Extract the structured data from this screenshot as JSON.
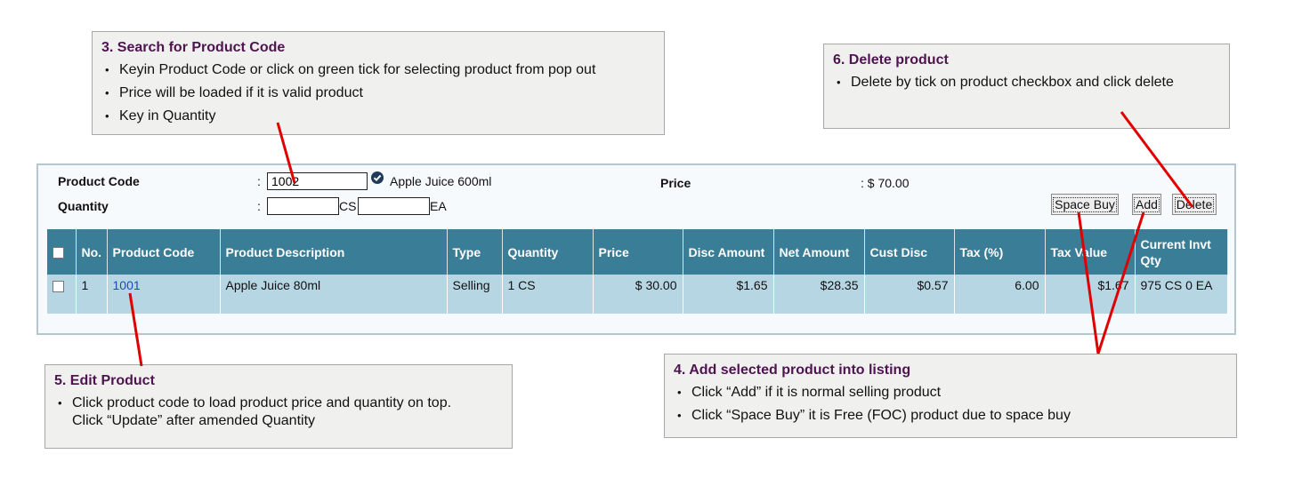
{
  "callouts": {
    "search": {
      "title": "3. Search for Product Code",
      "bullets": [
        "Keyin Product Code or click on green tick for selecting product from pop out",
        "Price will be loaded if it is valid product",
        "Key in Quantity"
      ]
    },
    "delete": {
      "title": "6. Delete product",
      "bullets": [
        "Delete by tick on product checkbox and click delete"
      ]
    },
    "edit": {
      "title": "5. Edit Product",
      "bullets": [
        "Click product code to load product price and quantity on top.\nClick “Update” after amended Quantity"
      ]
    },
    "add": {
      "title": "4. Add selected product into listing",
      "bullets": [
        "Click “Add” if it is normal selling product",
        "Click “Space Buy” it is Free (FOC) product due to space buy"
      ]
    }
  },
  "form": {
    "product_code_label": "Product Code",
    "quantity_label": "Quantity",
    "colon": ":",
    "product_code_value": "1002",
    "product_name": "Apple Juice 600ml",
    "price_label": "Price",
    "price_value": ": $ 70.00",
    "qty_cs_value": "",
    "qty_ea_value": "",
    "cs_unit": "CS",
    "ea_unit": "EA"
  },
  "buttons": {
    "space_buy": "Space Buy",
    "add": "Add",
    "delete": "Delete"
  },
  "table": {
    "headers": [
      "No.",
      "Product Code",
      "Product Description",
      "Type",
      "Quantity",
      "Price",
      "Disc Amount",
      "Net Amount",
      "Cust Disc",
      "Tax (%)",
      "Tax Value",
      "Current Invt Qty"
    ],
    "rows": [
      {
        "no": "1",
        "code": "1001",
        "description": "Apple Juice 80ml",
        "type": "Selling",
        "quantity": "1 CS",
        "price": "$ 30.00",
        "disc_amount": "$1.65",
        "net_amount": "$28.35",
        "cust_disc": "$0.57",
        "tax_pct": "6.00",
        "tax_value": "$1.67",
        "current_invt_qty": "975 CS 0 EA"
      }
    ]
  },
  "colors": {
    "header_bg": "#3a7d96",
    "row_bg": "#b7d6e4",
    "callout_title": "#4e1450",
    "pointer_line": "#e00000",
    "valid_tick": "#1e3c5a"
  }
}
